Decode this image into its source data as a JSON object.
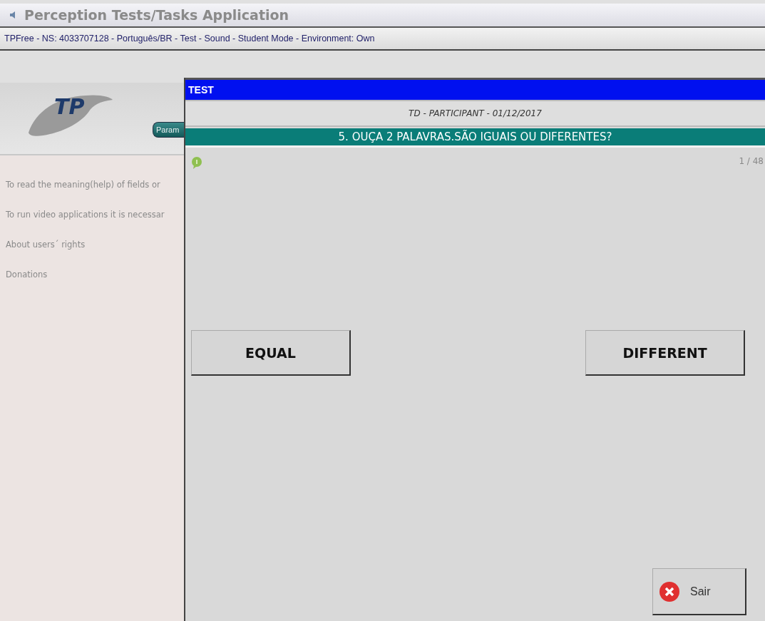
{
  "window": {
    "title": "Perception Tests/Tasks Application",
    "info": "TPFree - NS: 4033707128 - Português/BR - Test - Sound - Student Mode - Environment: Own"
  },
  "header": {
    "logo": "TP",
    "tab": "Param"
  },
  "sidebar": {
    "items": [
      "To read the meaning(help) of fields or",
      "To run video applications it is necessar",
      "About users´ rights",
      "Donations"
    ]
  },
  "dialog": {
    "title": "TEST",
    "subtitle": "TD - PARTICIPANT - 01/12/2017",
    "question": "5. OUÇA 2 PALAVRAS.SÃO IGUAIS OU DIFERENTES?",
    "counter": "1 / 48",
    "answers": [
      "EQUAL",
      "DIFFERENT"
    ],
    "exit": "Sair"
  }
}
